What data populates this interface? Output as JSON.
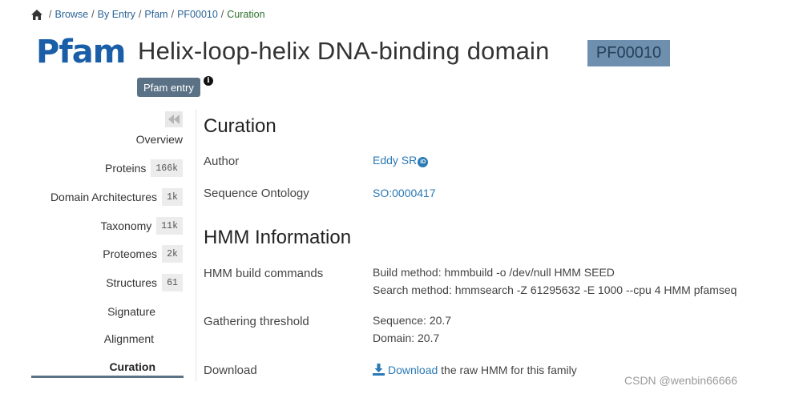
{
  "breadcrumb": {
    "items": [
      "Browse",
      "By Entry",
      "Pfam",
      "PF00010"
    ],
    "current": "Curation"
  },
  "header": {
    "logo_text": "Pfam",
    "title": "Helix-loop-helix DNA-binding domain",
    "accession": "PF00010",
    "entry_tag": "Pfam entry",
    "info_glyph": "i"
  },
  "sidebar": {
    "items": [
      {
        "label": "Overview",
        "count": null
      },
      {
        "label": "Proteins",
        "count": "166k"
      },
      {
        "label": "Domain Architectures",
        "count": "1k"
      },
      {
        "label": "Taxonomy",
        "count": "11k"
      },
      {
        "label": "Proteomes",
        "count": "2k"
      },
      {
        "label": "Structures",
        "count": "61"
      },
      {
        "label": "Signature",
        "count": null
      },
      {
        "label": "Alignment",
        "count": null
      },
      {
        "label": "Curation",
        "count": null
      }
    ],
    "active": "Curation"
  },
  "curation": {
    "title": "Curation",
    "author_label": "Author",
    "author_value": "Eddy SR",
    "author_badge": "iD",
    "ontology_label": "Sequence Ontology",
    "ontology_value": "SO:0000417"
  },
  "hmm": {
    "title": "HMM Information",
    "build_label": "HMM build commands",
    "build_line1": "Build method: hmmbuild -o /dev/null HMM SEED",
    "build_line2": "Search method: hmmsearch -Z 61295632 -E 1000 --cpu 4 HMM pfamseq",
    "threshold_label": "Gathering threshold",
    "threshold_line1": "Sequence: 20.7",
    "threshold_line2": "Domain: 20.7",
    "download_label": "Download",
    "download_link": "Download",
    "download_suffix": " the raw HMM for this family"
  },
  "watermark": "CSDN @wenbin66666",
  "colors": {
    "logo_blue": "#1a5ea8",
    "badge_bg": "#6e8fae",
    "tag_bg": "#5b7286",
    "link": "#2a7ab5"
  }
}
